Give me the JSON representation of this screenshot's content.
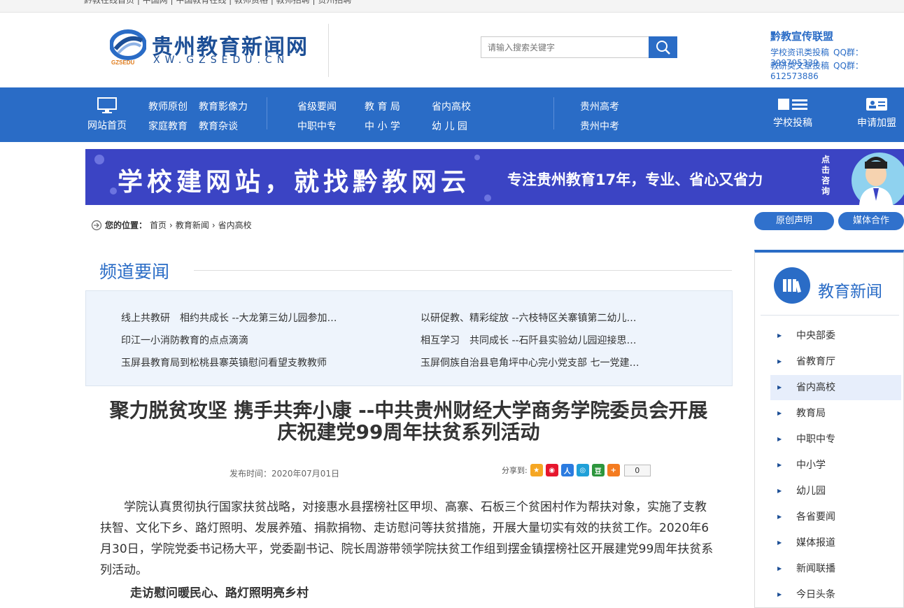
{
  "top_strip": {
    "text": "黔教在线首页 | 中国网 | 中国教育在线 | 教师资格 | 教师招聘 | 贵州招聘"
  },
  "header": {
    "logo_cn": "贵州教育新闻网",
    "logo_en": "XW.GZSEDU.CN",
    "logo_mark_text": "GZSEDU",
    "search": {
      "placeholder": "请输入搜索关键字"
    },
    "union": {
      "title": "黔教宣传联盟",
      "line1": {
        "label": "学校资讯类投稿",
        "qq": "QQ群：399795339"
      },
      "line2": {
        "label": "教研类文章投稿",
        "qq": "QQ群：612573886"
      }
    }
  },
  "nav": {
    "home": "网站首页",
    "group1": [
      "教师原创",
      "教育影像力",
      "家庭教育",
      "教育杂谈"
    ],
    "group2": [
      "省级要闻",
      "教 育 局",
      "省内高校",
      "中职中专",
      "中 小 学",
      "幼 儿 园"
    ],
    "group3": [
      "贵州高考",
      "贵州中考"
    ],
    "submit": "学校投稿",
    "join": "申请加盟"
  },
  "banner": {
    "main": "学校建网站，就找黔教网云",
    "sub": "专注贵州教育17年，专业、省心又省力",
    "vertical": "点击咨询"
  },
  "breadcrumb": {
    "label": "您的位置：",
    "items": [
      "首页",
      "教育新闻",
      "省内高校"
    ]
  },
  "pills": {
    "original": "原创声明",
    "media": "媒体合作"
  },
  "channel": {
    "title": "频道要闻",
    "news_left": [
      "线上共教研　相约共成长 --大龙第三幼儿园参加…",
      "印江一小消防教育的点点滴滴",
      "玉屏县教育局到松桃县寨英镇慰问看望支教教师"
    ],
    "news_right": [
      "以研促教、精彩绽放 --六枝特区关寨镇第二幼儿…",
      "相互学习　共同成长 --石阡县实验幼儿园迎接思…",
      "玉屏侗族自治县皂角坪中心完小党支部 七一党建…"
    ]
  },
  "article": {
    "title": "聚力脱贫攻坚 携手共奔小康 --中共贵州财经大学商务学院委员会开展庆祝建党99周年扶贫系列活动",
    "publish": "发布时间：2020年07月01日",
    "share_label": "分享到:",
    "share_count": "0",
    "paragraph1": "学院认真贯彻执行国家扶贫战略，对接惠水县摆榜社区甲坝、高寨、石板三个贫困村作为帮扶对象，实施了支教扶智、文化下乡、路灯照明、发展养殖、捐款捐物、走访慰问等扶贫措施，开展大量切实有效的扶贫工作。2020年6月30日，学院党委书记杨大平，党委副书记、院长周游带领学院扶贫工作组到摆金镇摆榜社区开展建党99周年扶贫系列活动。",
    "subhead": "走访慰问暖民心、路灯照明亮乡村"
  },
  "sidebar": {
    "title": "教育新闻",
    "items": [
      "中央部委",
      "省教育厅",
      "省内高校",
      "教育局",
      "中职中专",
      "中小学",
      "幼儿园",
      "各省要闻",
      "媒体报道",
      "新闻联播",
      "今日头条"
    ]
  },
  "colors": {
    "primary": "#2a6cc6",
    "banner": "#3b44c4",
    "highlight": "#e7eefb"
  }
}
